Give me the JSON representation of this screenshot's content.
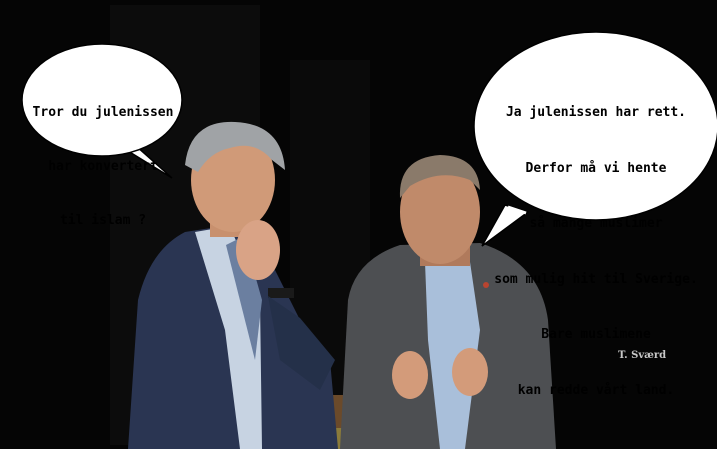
{
  "speech": {
    "left_lines": [
      "Tror du julenissen",
      "har konvertert",
      "til islam ?"
    ],
    "right_lines": [
      "Ja julenissen har rett.",
      "Derfor må vi hente",
      "så mange muslimer",
      "som mulig hit til Sverige.",
      "Bare muslimene",
      "kan redde vårt land."
    ]
  },
  "signature": "T. Sværd",
  "colors": {
    "background": "#050505",
    "bubble_fill": "#ffffff",
    "bubble_stroke": "#000000",
    "suit_left": "#2a3552",
    "suit_right": "#4d4f52"
  }
}
